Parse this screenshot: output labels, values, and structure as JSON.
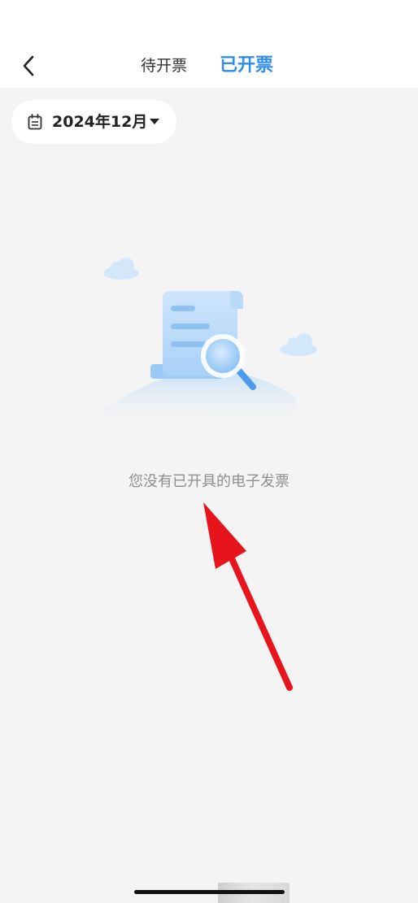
{
  "header": {
    "tabs": [
      {
        "label": "待开票",
        "active": false
      },
      {
        "label": "已开票",
        "active": true
      }
    ]
  },
  "filter": {
    "month": "2024年12月"
  },
  "empty_state": {
    "message": "您没有已开具的电子发票"
  },
  "colors": {
    "accent": "#2f8cf0",
    "background": "#f4f4f4",
    "annotation_arrow": "#e8141b"
  }
}
